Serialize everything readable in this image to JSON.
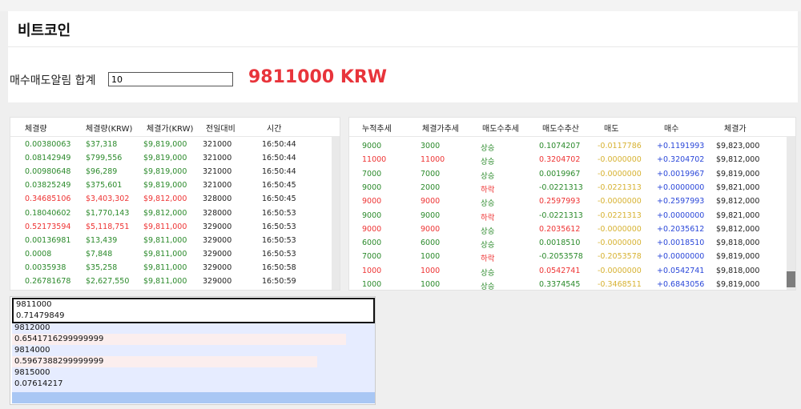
{
  "header": {
    "title": "비트코인"
  },
  "alarm": {
    "label": "매수매도알림 합계",
    "input_value": "10",
    "total": "9811000 KRW"
  },
  "trades": {
    "columns": [
      "체결량",
      "체결량(KRW)",
      "체결가(KRW)",
      "전일대비",
      "시간"
    ],
    "rows": [
      {
        "qty": "0.00380063",
        "krw": "$37,318",
        "price": "$9,819,000",
        "diff": "321000",
        "time": "16:50:44",
        "color": "g"
      },
      {
        "qty": "0.08142949",
        "krw": "$799,556",
        "price": "$9,819,000",
        "diff": "321000",
        "time": "16:50:44",
        "color": "g"
      },
      {
        "qty": "0.00980648",
        "krw": "$96,289",
        "price": "$9,819,000",
        "diff": "321000",
        "time": "16:50:44",
        "color": "g"
      },
      {
        "qty": "0.03825249",
        "krw": "$375,601",
        "price": "$9,819,000",
        "diff": "321000",
        "time": "16:50:45",
        "color": "g"
      },
      {
        "qty": "0.34685106",
        "krw": "$3,403,302",
        "price": "$9,812,000",
        "diff": "328000",
        "time": "16:50:45",
        "color": "r"
      },
      {
        "qty": "0.18040602",
        "krw": "$1,770,143",
        "price": "$9,812,000",
        "diff": "328000",
        "time": "16:50:53",
        "color": "g"
      },
      {
        "qty": "0.52173594",
        "krw": "$5,118,751",
        "price": "$9,811,000",
        "diff": "329000",
        "time": "16:50:53",
        "color": "r"
      },
      {
        "qty": "0.00136981",
        "krw": "$13,439",
        "price": "$9,811,000",
        "diff": "329000",
        "time": "16:50:53",
        "color": "g"
      },
      {
        "qty": "0.0008",
        "krw": "$7,848",
        "price": "$9,811,000",
        "diff": "329000",
        "time": "16:50:53",
        "color": "g"
      },
      {
        "qty": "0.0035938",
        "krw": "$35,258",
        "price": "$9,811,000",
        "diff": "329000",
        "time": "16:50:58",
        "color": "g"
      },
      {
        "qty": "0.26781678",
        "krw": "$2,627,550",
        "price": "$9,811,000",
        "diff": "329000",
        "time": "16:50:59",
        "color": "g"
      }
    ]
  },
  "trends": {
    "columns": [
      "누적추세",
      "체결가추세",
      "매도수추세",
      "매도수추산",
      "매도",
      "매수",
      "체결가"
    ],
    "rows": [
      {
        "acc": "9000",
        "pt": "3000",
        "dir": "상승",
        "calc": "0.1074207",
        "sell": "-0.0117786",
        "buy": "+0.1191993",
        "price": "$9,823,000",
        "c1": "g",
        "c2": "g",
        "c3": "g",
        "c4": "g"
      },
      {
        "acc": "11000",
        "pt": "11000",
        "dir": "상승",
        "calc": "0.3204702",
        "sell": "-0.0000000",
        "buy": "+0.3204702",
        "price": "$9,812,000",
        "c1": "r",
        "c2": "r",
        "c3": "g",
        "c4": "r"
      },
      {
        "acc": "7000",
        "pt": "7000",
        "dir": "상승",
        "calc": "0.0019967",
        "sell": "-0.0000000",
        "buy": "+0.0019967",
        "price": "$9,819,000",
        "c1": "g",
        "c2": "g",
        "c3": "g",
        "c4": "g"
      },
      {
        "acc": "9000",
        "pt": "2000",
        "dir": "하락",
        "calc": "-0.0221313",
        "sell": "-0.0221313",
        "buy": "+0.0000000",
        "price": "$9,821,000",
        "c1": "g",
        "c2": "g",
        "c3": "r",
        "c4": "g"
      },
      {
        "acc": "9000",
        "pt": "9000",
        "dir": "상승",
        "calc": "0.2597993",
        "sell": "-0.0000000",
        "buy": "+0.2597993",
        "price": "$9,812,000",
        "c1": "r",
        "c2": "r",
        "c3": "g",
        "c4": "r"
      },
      {
        "acc": "9000",
        "pt": "9000",
        "dir": "하락",
        "calc": "-0.0221313",
        "sell": "-0.0221313",
        "buy": "+0.0000000",
        "price": "$9,821,000",
        "c1": "g",
        "c2": "g",
        "c3": "r",
        "c4": "g"
      },
      {
        "acc": "9000",
        "pt": "9000",
        "dir": "상승",
        "calc": "0.2035612",
        "sell": "-0.0000000",
        "buy": "+0.2035612",
        "price": "$9,812,000",
        "c1": "r",
        "c2": "r",
        "c3": "g",
        "c4": "r"
      },
      {
        "acc": "6000",
        "pt": "6000",
        "dir": "상승",
        "calc": "0.0018510",
        "sell": "-0.0000000",
        "buy": "+0.0018510",
        "price": "$9,818,000",
        "c1": "g",
        "c2": "g",
        "c3": "g",
        "c4": "g"
      },
      {
        "acc": "7000",
        "pt": "1000",
        "dir": "하락",
        "calc": "-0.2053578",
        "sell": "-0.2053578",
        "buy": "+0.0000000",
        "price": "$9,819,000",
        "c1": "g",
        "c2": "g",
        "c3": "r",
        "c4": "g"
      },
      {
        "acc": "1000",
        "pt": "1000",
        "dir": "상승",
        "calc": "0.0542741",
        "sell": "-0.0000000",
        "buy": "+0.0542741",
        "price": "$9,818,000",
        "c1": "r",
        "c2": "r",
        "c3": "g",
        "c4": "r"
      },
      {
        "acc": "1000",
        "pt": "1000",
        "dir": "상승",
        "calc": "0.3374545",
        "sell": "-0.3468511",
        "buy": "+0.6843056",
        "price": "$9,819,000",
        "c1": "g",
        "c2": "g",
        "c3": "g",
        "c4": "g"
      }
    ]
  },
  "orderbook": {
    "ask": {
      "price": "9811000",
      "qty": "0.71479849"
    },
    "bids": [
      {
        "price": "9812000",
        "qty": "0.6541716299999999",
        "fill": 0.92
      },
      {
        "price": "9814000",
        "qty": "0.5967388299999999",
        "fill": 0.84
      },
      {
        "price": "9815000",
        "qty": "0.07614217",
        "fill": 0.0
      }
    ]
  }
}
